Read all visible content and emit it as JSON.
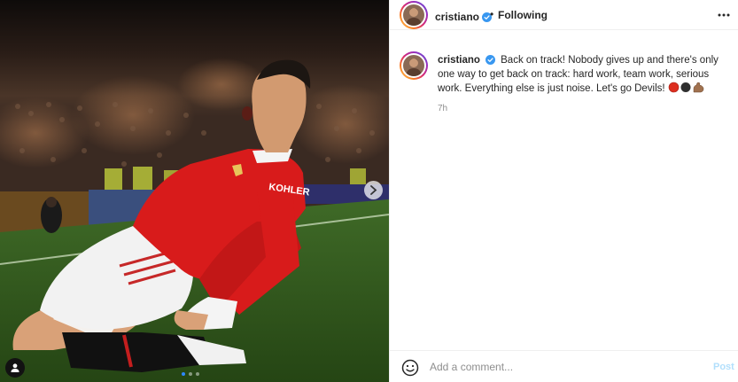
{
  "post": {
    "username": "cristiano",
    "separator": "•",
    "follow_status": "Following",
    "caption_username": "cristiano",
    "caption": "Back on track! Nobody gives up and there's only one way to get back on track: hard work, team work, serious work. Everything else is just noise. Let's go Devils!",
    "caption_emojis": [
      "red-circle",
      "black-circle",
      "flexed-biceps"
    ],
    "time": "7h",
    "photo_text": "KOHLER",
    "carousel": {
      "count": 3,
      "active_index": 0
    }
  },
  "comment": {
    "placeholder": "Add a comment...",
    "post_label": "Post"
  },
  "colors": {
    "verified_blue": "#3897f0",
    "post_disabled": "#b2dffc",
    "carousel_active": "#2d88ff"
  },
  "icons": {
    "verified": "verified-badge-icon",
    "more": "more-options-icon",
    "next": "chevron-right-icon",
    "tag": "user-tag-icon",
    "emoji": "emoji-smile-icon"
  }
}
